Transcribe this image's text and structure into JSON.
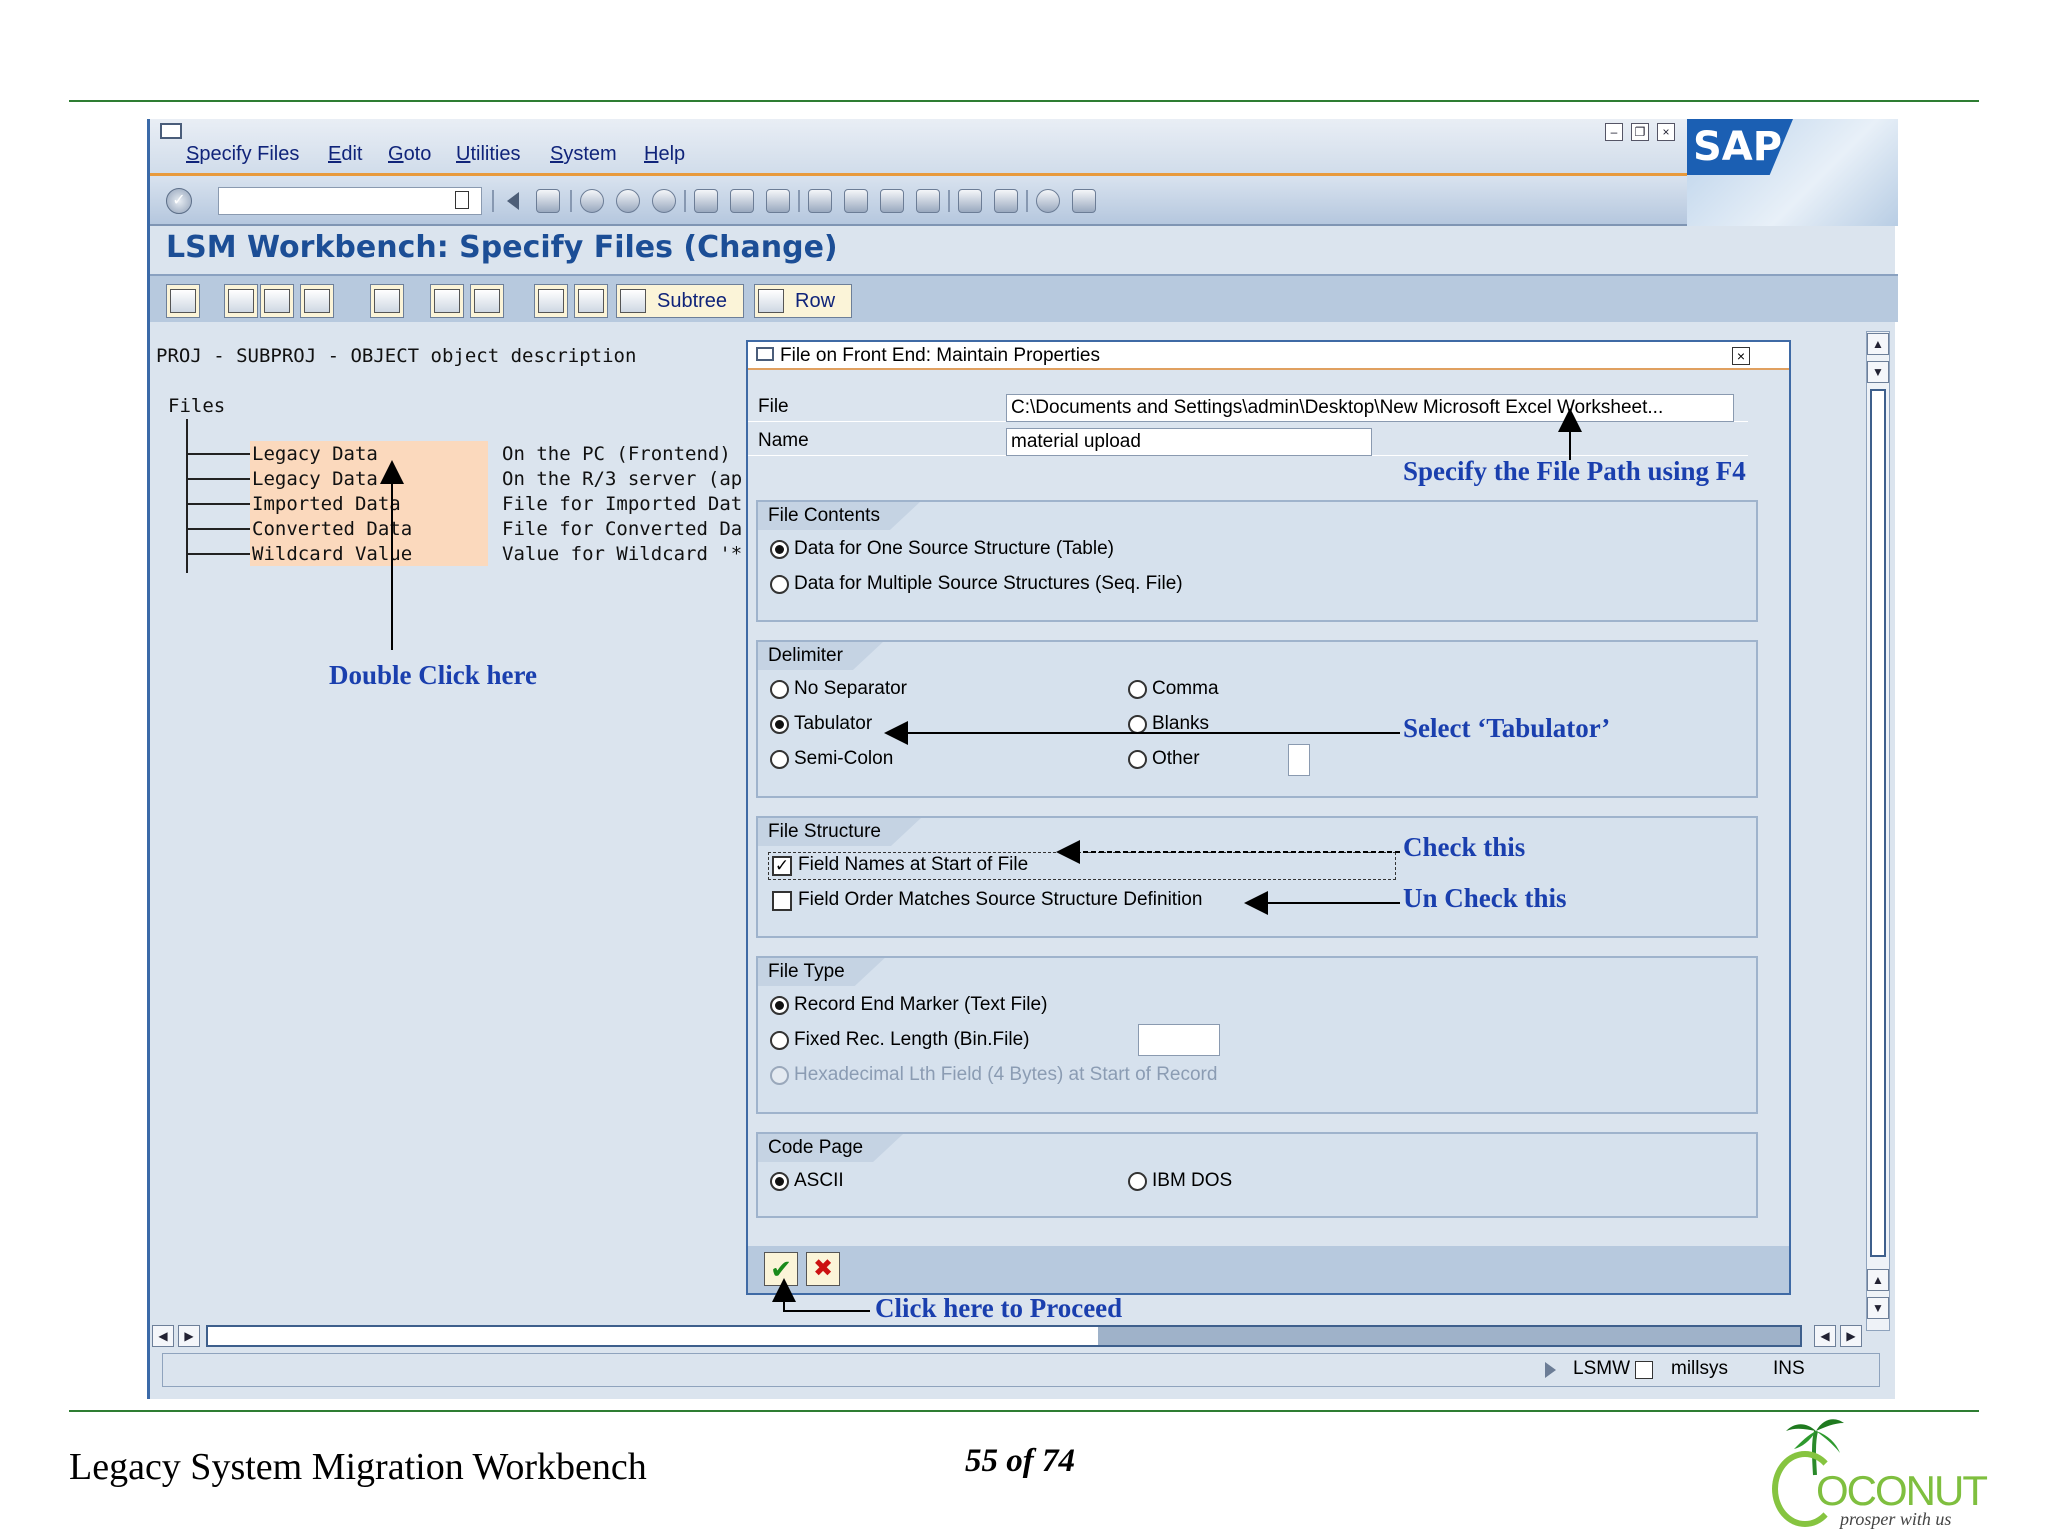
{
  "menu": {
    "items": [
      "Specify Files",
      "Edit",
      "Goto",
      "Utilities",
      "System",
      "Help"
    ]
  },
  "sap_logo": "SAP",
  "screen_title": "LSM Workbench: Specify Files (Change)",
  "app_toolbar": {
    "subtree": "Subtree",
    "row": "Row"
  },
  "tree": {
    "header": "PROJ - SUBPROJ - OBJECT object description",
    "root": "Files",
    "items": [
      {
        "name": "Legacy Data",
        "desc": "On the PC (Frontend)"
      },
      {
        "name": "Legacy Data",
        "desc": "On the R/3 server (ap"
      },
      {
        "name": "Imported Data",
        "desc": "File for Imported Dat"
      },
      {
        "name": "Converted Data",
        "desc": "File for Converted Da"
      },
      {
        "name": "Wildcard Value",
        "desc": "Value for Wildcard '*"
      }
    ]
  },
  "dialog": {
    "title": "File on Front End: Maintain Properties",
    "file_label": "File",
    "file_value": "C:\\Documents and Settings\\admin\\Desktop\\New Microsoft Excel Worksheet...",
    "name_label": "Name",
    "name_value": "material upload",
    "file_contents": {
      "title": "File Contents",
      "opt1": "Data for One Source Structure (Table)",
      "opt2": "Data for Multiple Source Structures (Seq. File)"
    },
    "delimiter": {
      "title": "Delimiter",
      "no_sep": "No Separator",
      "tab": "Tabulator",
      "semi": "Semi-Colon",
      "comma": "Comma",
      "blanks": "Blanks",
      "other": "Other"
    },
    "file_structure": {
      "title": "File Structure",
      "fieldnames": "Field Names at Start of File",
      "fieldorder": "Field Order Matches Source Structure Definition"
    },
    "file_type": {
      "title": "File Type",
      "rec_end": "Record End Marker (Text File)",
      "fixed": "Fixed Rec. Length (Bin.File)",
      "hex": "Hexadecimal Lth Field (4 Bytes) at Start of Record"
    },
    "code_page": {
      "title": "Code Page",
      "ascii": "ASCII",
      "ibm": "IBM DOS"
    }
  },
  "annotations": {
    "file_path": "Specify the File Path  using F4",
    "double_click": "Double Click here",
    "tabulator": "Select ‘Tabulator’",
    "check": "Check this",
    "uncheck": "Un Check this",
    "proceed": "Click here to Proceed"
  },
  "status": {
    "tx": "LSMW",
    "server": "millsys",
    "mode": "INS"
  },
  "footer": {
    "title": "Legacy System Migration Workbench",
    "page": "55 of 74",
    "logo_text": "OCONUT",
    "tagline": "prosper with us"
  },
  "colors": {
    "annotation": "#1a3fae",
    "sap_blue": "#1c4e96",
    "tree_highlight": "#fbd9bd",
    "rule": "#2e7d32"
  }
}
